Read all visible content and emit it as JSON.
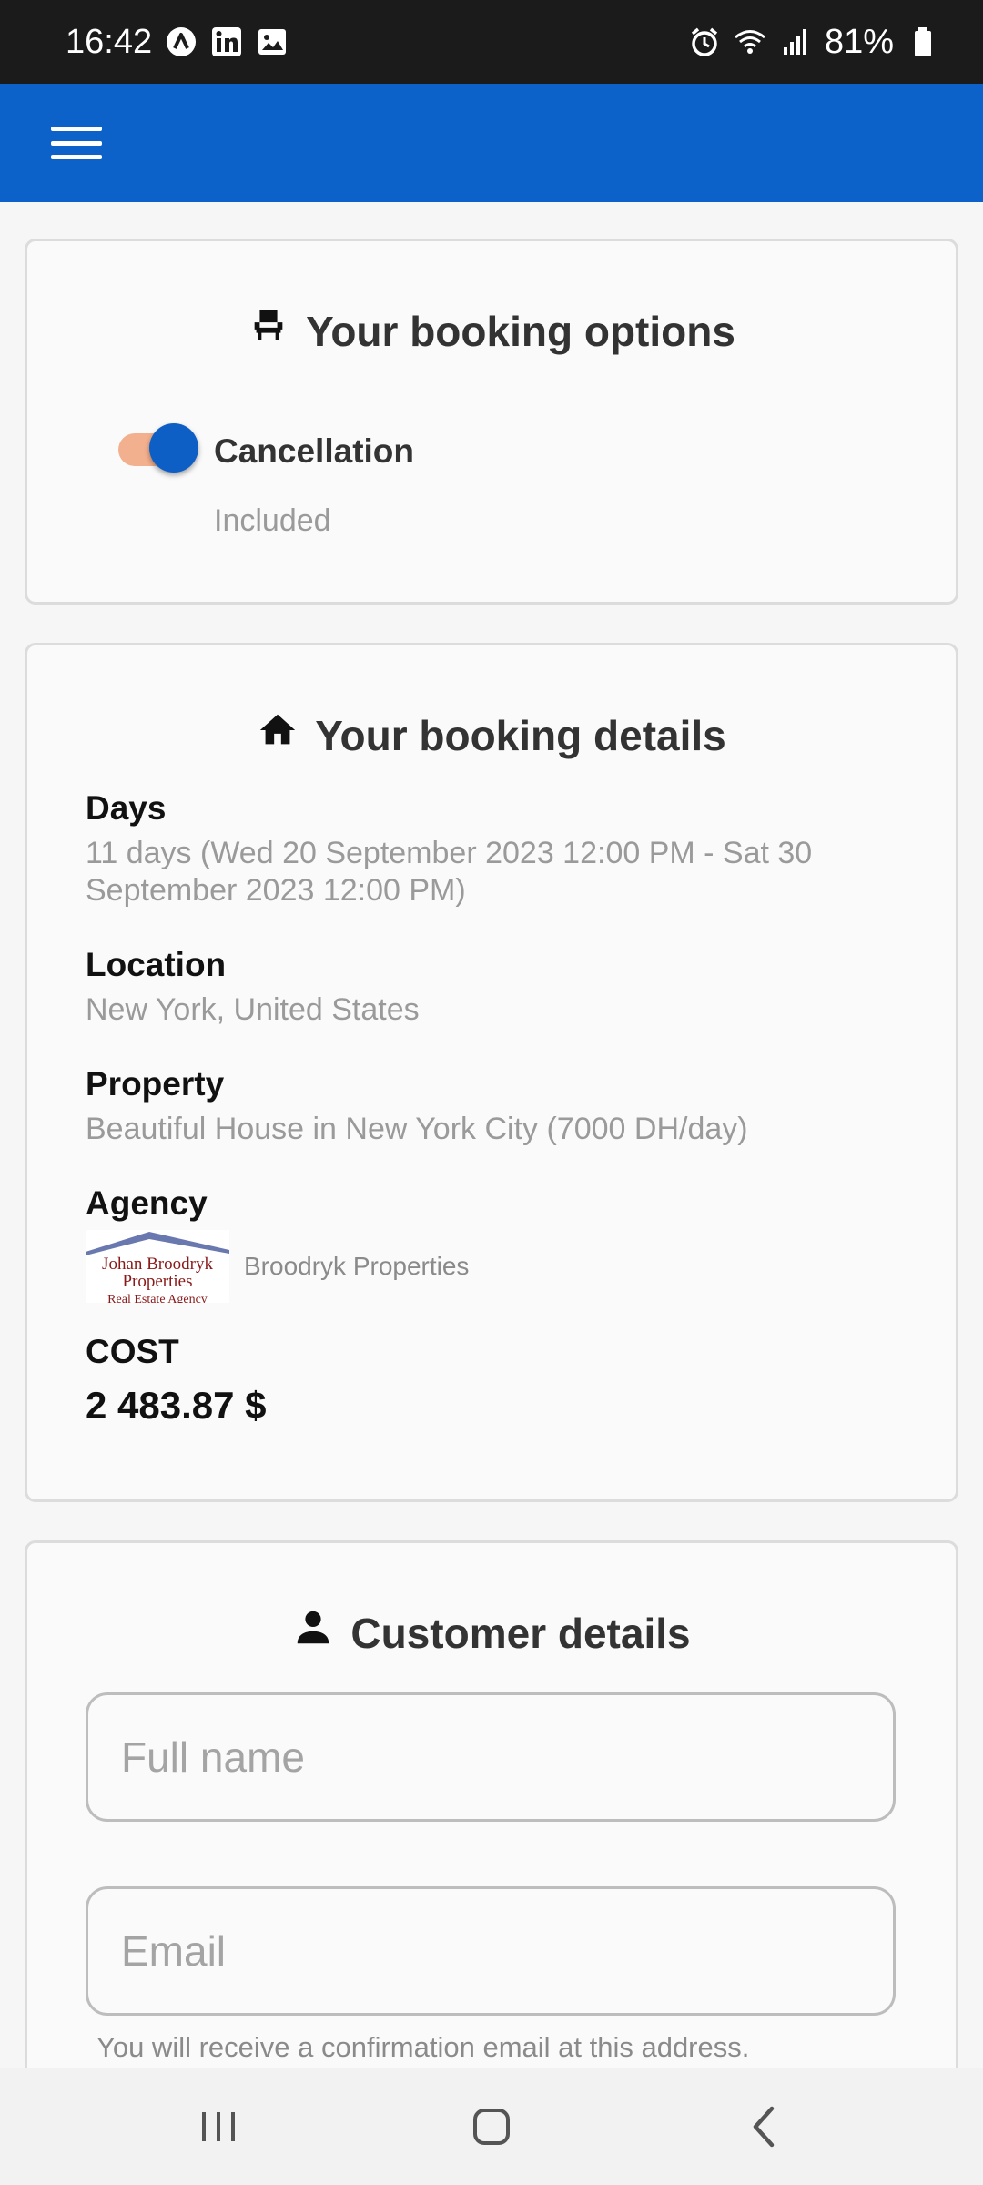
{
  "status_bar": {
    "time": "16:42",
    "battery": "81%",
    "left_icons": [
      "a-circle-icon",
      "linkedin-icon",
      "image-icon"
    ],
    "right_icons": [
      "alarm-icon",
      "wifi-icon",
      "signal-icon",
      "battery-icon"
    ]
  },
  "app_bar": {
    "menu_icon": "menu-icon"
  },
  "booking_options": {
    "title": "Your booking options",
    "icon": "seat-icon",
    "option_label": "Cancellation",
    "option_status": "Included",
    "toggle_on": true
  },
  "booking_details": {
    "title": "Your booking details",
    "icon": "home-icon",
    "days_label": "Days",
    "days_value": "11 days (Wed 20 September 2023 12:00 PM - Sat 30 September 2023 12:00 PM)",
    "location_label": "Location",
    "location_value": "New York, United States",
    "property_label": "Property",
    "property_value": "Beautiful House in New York City (7000  DH/day)",
    "agency_label": "Agency",
    "agency_logo_lines": [
      "Johan Broodryk",
      "Properties",
      "Real Estate Agency"
    ],
    "agency_name": "Broodryk Properties",
    "cost_label": "COST",
    "cost_value": "2 483.87 $"
  },
  "customer_details": {
    "title": "Customer details",
    "icon": "person-icon",
    "full_name_placeholder": "Full name",
    "full_name_value": "",
    "email_placeholder": "Email",
    "email_value": "",
    "email_hint": "You will receive a confirmation email at this address."
  },
  "colors": {
    "app_bar": "#0d62c9",
    "toggle_thumb": "#0d5fc6",
    "toggle_track": "#f3b08e",
    "status_bar": "#1b1b1b"
  },
  "nav_bar": {
    "icons": [
      "recent-apps-icon",
      "home-button-icon",
      "back-icon"
    ]
  }
}
